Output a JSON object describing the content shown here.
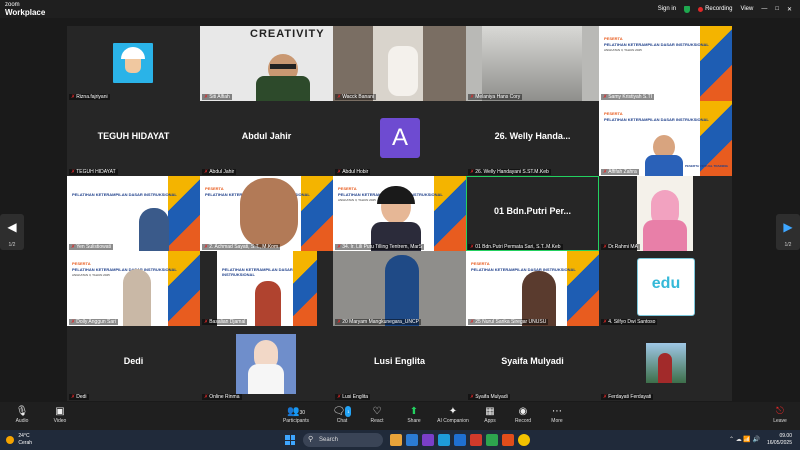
{
  "app": {
    "brand_top": "zoom",
    "brand_bottom": "Workplace",
    "sign_in": "Sign in",
    "recording": "Recording",
    "view": "View"
  },
  "page": {
    "current": "1/2"
  },
  "tiles": [
    {
      "name": "Rizna.fajriyani",
      "display": ""
    },
    {
      "name": "Siti Alfiah",
      "display": ""
    },
    {
      "name": "Wacck Banani",
      "display": ""
    },
    {
      "name": "Melaniya Hans Cory",
      "display": ""
    },
    {
      "name": "Samy Kristiyah S.TI",
      "display": ""
    },
    {
      "name": "TEGUH HIDAYAT",
      "display": "TEGUH HIDAYAT"
    },
    {
      "name": "Abdul Jahir",
      "display": "Abdul Jahir"
    },
    {
      "name": "Abdul Hobir",
      "display": "",
      "initial": "A"
    },
    {
      "name": "26. Welly Handayani S.ST.M.Keb",
      "display": "26. Welly Handa..."
    },
    {
      "name": "Affifah Zahra",
      "display": ""
    },
    {
      "name": "Yen Sulistiowati",
      "display": ""
    },
    {
      "name": "2. Achmad Sayati, S.T., M.Kom",
      "display": ""
    },
    {
      "name": "34. Ir. Lili Putu Tilling Tentrem, MarS",
      "display": ""
    },
    {
      "name": "01 Bdn.Putri Permata Sari, S.T..M.Keb",
      "display": "01 Bdn.Putri Per..."
    },
    {
      "name": "Dr.Rahmi MA",
      "display": ""
    },
    {
      "name": "Dolly Anggun Sari",
      "display": ""
    },
    {
      "name": "Basalian Djamal",
      "display": ""
    },
    {
      "name": "20 Maryam Mangkunegara_UNCP",
      "display": ""
    },
    {
      "name": "25 Nurul Sarika Siregar UNUSU",
      "display": ""
    },
    {
      "name": "4. Silfyo Dwi Santoso",
      "display": ""
    },
    {
      "name": "Dedi",
      "display": "Dedi"
    },
    {
      "name": "Online Rinma",
      "display": ""
    },
    {
      "name": "Lusi Englita",
      "display": "Lusi Englita"
    },
    {
      "name": "Syaifa Mulyadi",
      "display": "Syaifa Mulyadi"
    },
    {
      "name": "Ferdayati Ferdayati",
      "display": ""
    }
  ],
  "slide": {
    "line1": "PESERTA",
    "line2": "PELATIHAN KETERAMPILAN DASAR INSTRUKSIONAL",
    "line3": "ANGKATAN II, TAHUN 2025",
    "line4": "PESERTA VIRTUAL TRAINING"
  },
  "creativity_word": "CREATIVITY",
  "edu_word": "edu",
  "toolbar": {
    "audio": "Audio",
    "video": "Video",
    "participants": "Participants",
    "participants_count": "30",
    "chat": "Chat",
    "chat_badge": "1",
    "react": "React",
    "share": "Share",
    "ai": "AI Companion",
    "apps": "Apps",
    "record": "Record",
    "more": "More",
    "leave": "Leave"
  },
  "taskbar": {
    "temp": "24°C",
    "weather": "Cerah",
    "search": "Search",
    "time": "09.00",
    "date": "16/05/2025"
  },
  "colors": {
    "accent": "#23d160",
    "record": "#e02828",
    "avatar": "#6e4bd1"
  }
}
